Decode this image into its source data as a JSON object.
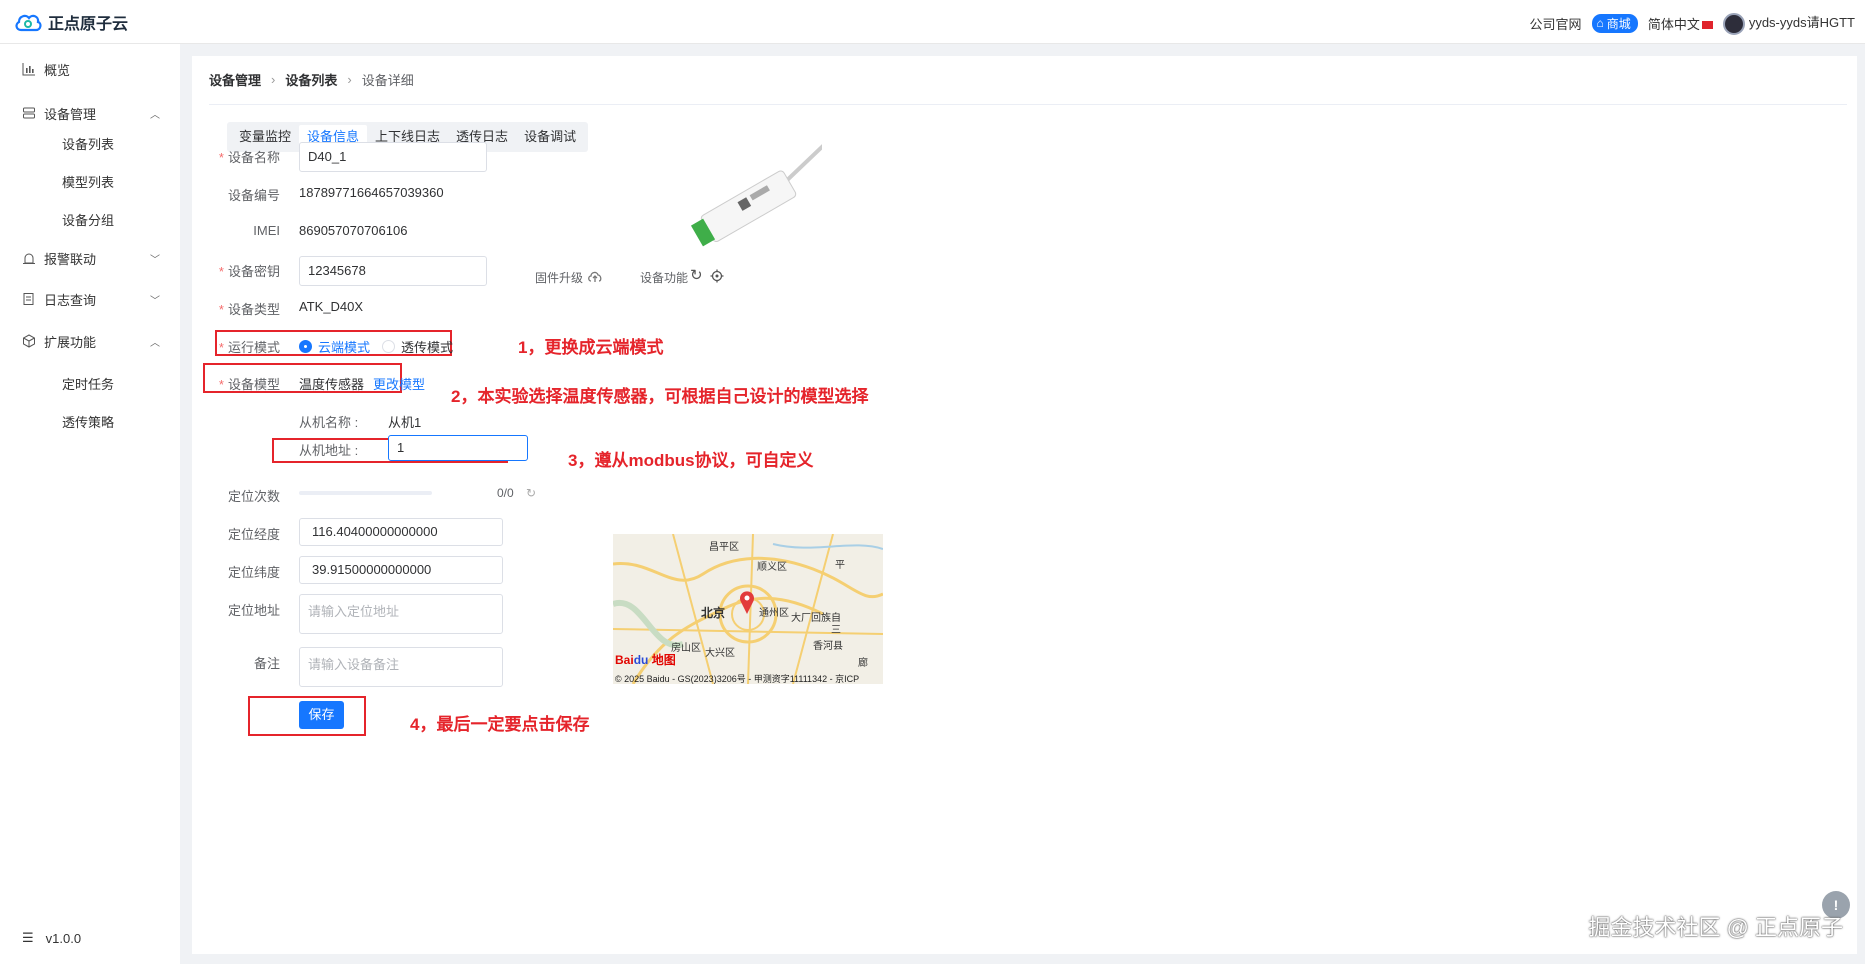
{
  "header": {
    "brand": "正点原子云",
    "links": {
      "official": "公司官网",
      "shop": "商城",
      "language": "简体中文"
    },
    "username": "yyds-yyds请HGTT"
  },
  "sidebar": {
    "items": [
      {
        "label": "概览",
        "icon": "bar-chart-icon"
      },
      {
        "label": "设备管理",
        "icon": "server-icon",
        "expanded": true,
        "children": [
          "设备列表",
          "模型列表",
          "设备分组"
        ]
      },
      {
        "label": "报警联动",
        "icon": "alarm-icon",
        "expanded": false
      },
      {
        "label": "日志查询",
        "icon": "log-icon",
        "expanded": false
      },
      {
        "label": "扩展功能",
        "icon": "cube-icon",
        "expanded": true,
        "children": [
          "定时任务",
          "透传策略"
        ]
      }
    ],
    "version": "v1.0.0"
  },
  "breadcrumb": [
    "设备管理",
    "设备列表",
    "设备详细"
  ],
  "tabs": {
    "items": [
      "变量监控",
      "设备信息",
      "上下线日志",
      "透传日志",
      "设备调试"
    ],
    "active": "设备信息"
  },
  "form": {
    "device_name": {
      "label": "设备名称",
      "value": "D40_1"
    },
    "device_id": {
      "label": "设备编号",
      "value": "1878977166465703936​0"
    },
    "imei": {
      "label": "IMEI",
      "value": "869057070706106"
    },
    "device_secret": {
      "label": "设备密钥",
      "value": "12345678"
    },
    "device_type": {
      "label": "设备类型",
      "value": "ATK_D40X"
    },
    "run_mode": {
      "label": "运行模式",
      "options": [
        "云端模式",
        "透传模式"
      ],
      "selected": "云端模式"
    },
    "device_model": {
      "label": "设备模型",
      "value": "温度传感器",
      "change_link": "更改模型"
    },
    "slave_name": {
      "label": "从机名称 :",
      "value": "从机1"
    },
    "slave_address": {
      "label": "从机地址 :",
      "value": "1"
    },
    "locate_count": {
      "label": "定位次数",
      "value": "0/0",
      "progress": 0
    },
    "longitude": {
      "label": "定位经度",
      "value": "116.40400000000000"
    },
    "latitude": {
      "label": "定位纬度",
      "value": "39.91500000000000"
    },
    "address": {
      "label": "定位地址",
      "placeholder": "请输入定位地址"
    },
    "remark": {
      "label": "备注",
      "placeholder": "请输入设备备注"
    },
    "save": "保存"
  },
  "device_actions": {
    "firmware": "固件升级",
    "function": "设备功能"
  },
  "map": {
    "labels": [
      "昌平区",
      "顺义区",
      "平",
      "北京",
      "通州区",
      "大厂回族自",
      "三",
      "房山区",
      "大兴区",
      "香河县",
      "廊"
    ],
    "copyright": "© 2025 Baidu - GS(2023)3206号 - 甲测资字11111342 - 京ICP"
  },
  "annotations": {
    "a1": "1，更换成云端模式",
    "a2": "2，本实验选择温度传感器，可根据自己设计的模型选择",
    "a3": "3，遵从modbus协议，可自定义",
    "a4": "4，最后一定要点击保存"
  },
  "watermark": "掘金技术社区 @ 正点原子",
  "colors": {
    "primary": "#1677ff",
    "annotation": "#e5242b",
    "required": "#f56c6c"
  }
}
